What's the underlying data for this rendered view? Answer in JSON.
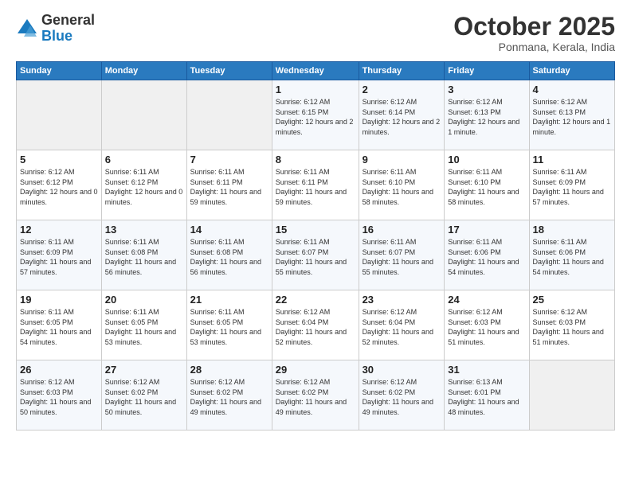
{
  "header": {
    "logo_line1": "General",
    "logo_line2": "Blue",
    "month": "October 2025",
    "location": "Ponmana, Kerala, India"
  },
  "weekdays": [
    "Sunday",
    "Monday",
    "Tuesday",
    "Wednesday",
    "Thursday",
    "Friday",
    "Saturday"
  ],
  "weeks": [
    [
      {
        "day": "",
        "info": ""
      },
      {
        "day": "",
        "info": ""
      },
      {
        "day": "",
        "info": ""
      },
      {
        "day": "1",
        "info": "Sunrise: 6:12 AM\nSunset: 6:15 PM\nDaylight: 12 hours and 2 minutes."
      },
      {
        "day": "2",
        "info": "Sunrise: 6:12 AM\nSunset: 6:14 PM\nDaylight: 12 hours and 2 minutes."
      },
      {
        "day": "3",
        "info": "Sunrise: 6:12 AM\nSunset: 6:13 PM\nDaylight: 12 hours and 1 minute."
      },
      {
        "day": "4",
        "info": "Sunrise: 6:12 AM\nSunset: 6:13 PM\nDaylight: 12 hours and 1 minute."
      }
    ],
    [
      {
        "day": "5",
        "info": "Sunrise: 6:12 AM\nSunset: 6:12 PM\nDaylight: 12 hours and 0 minutes."
      },
      {
        "day": "6",
        "info": "Sunrise: 6:11 AM\nSunset: 6:12 PM\nDaylight: 12 hours and 0 minutes."
      },
      {
        "day": "7",
        "info": "Sunrise: 6:11 AM\nSunset: 6:11 PM\nDaylight: 11 hours and 59 minutes."
      },
      {
        "day": "8",
        "info": "Sunrise: 6:11 AM\nSunset: 6:11 PM\nDaylight: 11 hours and 59 minutes."
      },
      {
        "day": "9",
        "info": "Sunrise: 6:11 AM\nSunset: 6:10 PM\nDaylight: 11 hours and 58 minutes."
      },
      {
        "day": "10",
        "info": "Sunrise: 6:11 AM\nSunset: 6:10 PM\nDaylight: 11 hours and 58 minutes."
      },
      {
        "day": "11",
        "info": "Sunrise: 6:11 AM\nSunset: 6:09 PM\nDaylight: 11 hours and 57 minutes."
      }
    ],
    [
      {
        "day": "12",
        "info": "Sunrise: 6:11 AM\nSunset: 6:09 PM\nDaylight: 11 hours and 57 minutes."
      },
      {
        "day": "13",
        "info": "Sunrise: 6:11 AM\nSunset: 6:08 PM\nDaylight: 11 hours and 56 minutes."
      },
      {
        "day": "14",
        "info": "Sunrise: 6:11 AM\nSunset: 6:08 PM\nDaylight: 11 hours and 56 minutes."
      },
      {
        "day": "15",
        "info": "Sunrise: 6:11 AM\nSunset: 6:07 PM\nDaylight: 11 hours and 55 minutes."
      },
      {
        "day": "16",
        "info": "Sunrise: 6:11 AM\nSunset: 6:07 PM\nDaylight: 11 hours and 55 minutes."
      },
      {
        "day": "17",
        "info": "Sunrise: 6:11 AM\nSunset: 6:06 PM\nDaylight: 11 hours and 54 minutes."
      },
      {
        "day": "18",
        "info": "Sunrise: 6:11 AM\nSunset: 6:06 PM\nDaylight: 11 hours and 54 minutes."
      }
    ],
    [
      {
        "day": "19",
        "info": "Sunrise: 6:11 AM\nSunset: 6:05 PM\nDaylight: 11 hours and 54 minutes."
      },
      {
        "day": "20",
        "info": "Sunrise: 6:11 AM\nSunset: 6:05 PM\nDaylight: 11 hours and 53 minutes."
      },
      {
        "day": "21",
        "info": "Sunrise: 6:11 AM\nSunset: 6:05 PM\nDaylight: 11 hours and 53 minutes."
      },
      {
        "day": "22",
        "info": "Sunrise: 6:12 AM\nSunset: 6:04 PM\nDaylight: 11 hours and 52 minutes."
      },
      {
        "day": "23",
        "info": "Sunrise: 6:12 AM\nSunset: 6:04 PM\nDaylight: 11 hours and 52 minutes."
      },
      {
        "day": "24",
        "info": "Sunrise: 6:12 AM\nSunset: 6:03 PM\nDaylight: 11 hours and 51 minutes."
      },
      {
        "day": "25",
        "info": "Sunrise: 6:12 AM\nSunset: 6:03 PM\nDaylight: 11 hours and 51 minutes."
      }
    ],
    [
      {
        "day": "26",
        "info": "Sunrise: 6:12 AM\nSunset: 6:03 PM\nDaylight: 11 hours and 50 minutes."
      },
      {
        "day": "27",
        "info": "Sunrise: 6:12 AM\nSunset: 6:02 PM\nDaylight: 11 hours and 50 minutes."
      },
      {
        "day": "28",
        "info": "Sunrise: 6:12 AM\nSunset: 6:02 PM\nDaylight: 11 hours and 49 minutes."
      },
      {
        "day": "29",
        "info": "Sunrise: 6:12 AM\nSunset: 6:02 PM\nDaylight: 11 hours and 49 minutes."
      },
      {
        "day": "30",
        "info": "Sunrise: 6:12 AM\nSunset: 6:02 PM\nDaylight: 11 hours and 49 minutes."
      },
      {
        "day": "31",
        "info": "Sunrise: 6:13 AM\nSunset: 6:01 PM\nDaylight: 11 hours and 48 minutes."
      },
      {
        "day": "",
        "info": ""
      }
    ]
  ]
}
